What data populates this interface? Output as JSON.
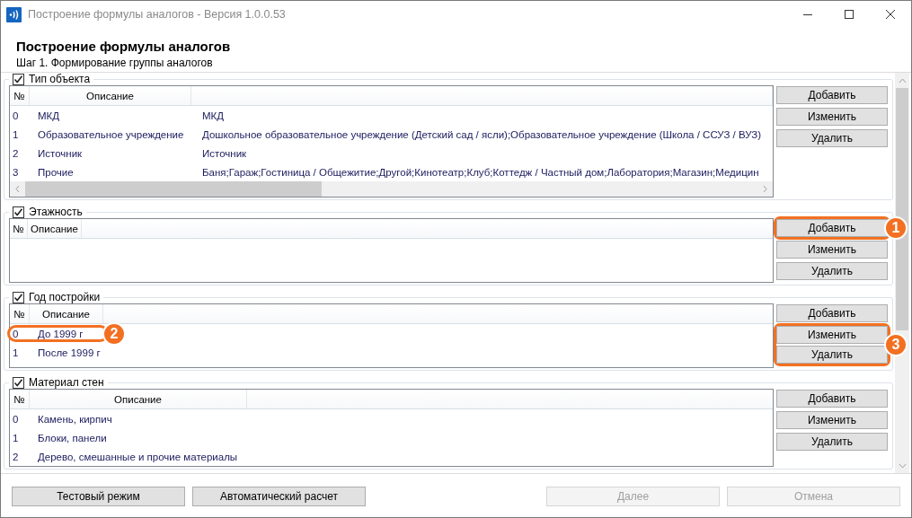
{
  "window": {
    "title": "Построение формулы аналогов - Версия 1.0.0.53"
  },
  "header": {
    "title": "Построение формулы аналогов",
    "subtitle": "Шаг 1. Формирование группы аналогов"
  },
  "sections": [
    {
      "title": "Тип объекта",
      "checked": true,
      "horizontal_scrollbar": true,
      "columns": [
        "№",
        "Описание",
        null
      ],
      "rows": [
        {
          "cells": [
            "0",
            "МКД",
            "МКД"
          ],
          "highlighted": false
        },
        {
          "cells": [
            "1",
            "Образовательное учреждение",
            "Дошкольное образовательное учреждение (Детский сад / ясли);Образовательное учреждение (Школа / ССУЗ / ВУЗ)"
          ],
          "highlighted": false
        },
        {
          "cells": [
            "2",
            "Источник",
            "Источник"
          ],
          "highlighted": false
        },
        {
          "cells": [
            "3",
            "Прочие",
            "Баня;Гараж;Гостиница / Общежитие;Другой;Кинотеатр;Клуб;Коттедж / Частный дом;Лаборатория;Магазин;Медицин"
          ],
          "highlighted": false
        }
      ],
      "buttons": [
        {
          "label": "Добавить",
          "highlighted": false
        },
        {
          "label": "Изменить",
          "highlighted": false
        },
        {
          "label": "Удалить",
          "highlighted": false
        }
      ]
    },
    {
      "title": "Этажность",
      "checked": true,
      "horizontal_scrollbar": false,
      "columns": [
        "№",
        "Описание"
      ],
      "buttons": [
        {
          "label": "Добавить",
          "highlighted": true
        },
        {
          "label": "Изменить",
          "highlighted": false
        },
        {
          "label": "Удалить",
          "highlighted": false
        }
      ],
      "buttons_badge": "1"
    },
    {
      "title": "Год постройки",
      "checked": true,
      "horizontal_scrollbar": false,
      "columns": [
        "№",
        "Описание"
      ],
      "rows": [
        {
          "cells": [
            "0",
            "До 1999 г"
          ],
          "highlighted": true,
          "badge": "2"
        },
        {
          "cells": [
            "1",
            "После 1999 г"
          ],
          "highlighted": false
        }
      ],
      "buttons": [
        {
          "label": "Добавить",
          "highlighted": false
        },
        {
          "label": "Изменить",
          "highlighted": true
        },
        {
          "label": "Удалить",
          "highlighted": true
        }
      ],
      "buttons_badge": "3"
    },
    {
      "title": "Материал стен",
      "checked": true,
      "horizontal_scrollbar": false,
      "columns": [
        "№",
        "Описание"
      ],
      "rows": [
        {
          "cells": [
            "0",
            "Камень, кирпич"
          ],
          "highlighted": false
        },
        {
          "cells": [
            "1",
            "Блоки, панели"
          ],
          "highlighted": false
        },
        {
          "cells": [
            "2",
            "Дерево, смешанные и прочие материалы"
          ],
          "highlighted": false
        }
      ],
      "buttons": [
        {
          "label": "Добавить",
          "highlighted": false
        },
        {
          "label": "Изменить",
          "highlighted": false
        },
        {
          "label": "Удалить",
          "highlighted": false
        }
      ]
    }
  ],
  "footer": {
    "buttons": [
      {
        "label": "Тестовый режим",
        "disabled": false
      },
      {
        "label": "Автоматический расчет",
        "disabled": false
      },
      {
        "label": "Далее",
        "disabled": true
      },
      {
        "label": "Отмена",
        "disabled": true
      }
    ]
  }
}
